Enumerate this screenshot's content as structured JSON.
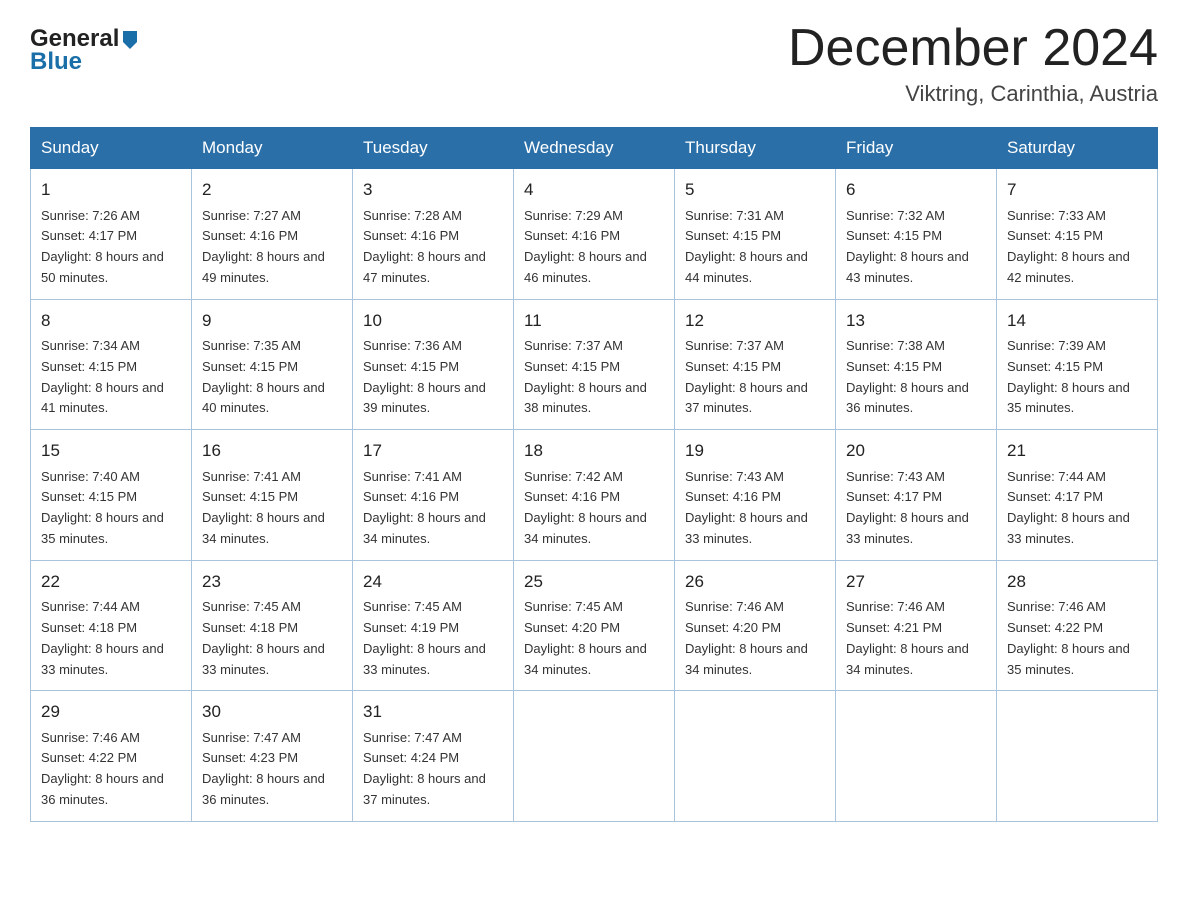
{
  "header": {
    "logo_general": "General",
    "logo_blue": "Blue",
    "month_title": "December 2024",
    "location": "Viktring, Carinthia, Austria"
  },
  "days_of_week": [
    "Sunday",
    "Monday",
    "Tuesday",
    "Wednesday",
    "Thursday",
    "Friday",
    "Saturday"
  ],
  "weeks": [
    [
      {
        "day": "1",
        "sunrise": "7:26 AM",
        "sunset": "4:17 PM",
        "daylight": "8 hours and 50 minutes."
      },
      {
        "day": "2",
        "sunrise": "7:27 AM",
        "sunset": "4:16 PM",
        "daylight": "8 hours and 49 minutes."
      },
      {
        "day": "3",
        "sunrise": "7:28 AM",
        "sunset": "4:16 PM",
        "daylight": "8 hours and 47 minutes."
      },
      {
        "day": "4",
        "sunrise": "7:29 AM",
        "sunset": "4:16 PM",
        "daylight": "8 hours and 46 minutes."
      },
      {
        "day": "5",
        "sunrise": "7:31 AM",
        "sunset": "4:15 PM",
        "daylight": "8 hours and 44 minutes."
      },
      {
        "day": "6",
        "sunrise": "7:32 AM",
        "sunset": "4:15 PM",
        "daylight": "8 hours and 43 minutes."
      },
      {
        "day": "7",
        "sunrise": "7:33 AM",
        "sunset": "4:15 PM",
        "daylight": "8 hours and 42 minutes."
      }
    ],
    [
      {
        "day": "8",
        "sunrise": "7:34 AM",
        "sunset": "4:15 PM",
        "daylight": "8 hours and 41 minutes."
      },
      {
        "day": "9",
        "sunrise": "7:35 AM",
        "sunset": "4:15 PM",
        "daylight": "8 hours and 40 minutes."
      },
      {
        "day": "10",
        "sunrise": "7:36 AM",
        "sunset": "4:15 PM",
        "daylight": "8 hours and 39 minutes."
      },
      {
        "day": "11",
        "sunrise": "7:37 AM",
        "sunset": "4:15 PM",
        "daylight": "8 hours and 38 minutes."
      },
      {
        "day": "12",
        "sunrise": "7:37 AM",
        "sunset": "4:15 PM",
        "daylight": "8 hours and 37 minutes."
      },
      {
        "day": "13",
        "sunrise": "7:38 AM",
        "sunset": "4:15 PM",
        "daylight": "8 hours and 36 minutes."
      },
      {
        "day": "14",
        "sunrise": "7:39 AM",
        "sunset": "4:15 PM",
        "daylight": "8 hours and 35 minutes."
      }
    ],
    [
      {
        "day": "15",
        "sunrise": "7:40 AM",
        "sunset": "4:15 PM",
        "daylight": "8 hours and 35 minutes."
      },
      {
        "day": "16",
        "sunrise": "7:41 AM",
        "sunset": "4:15 PM",
        "daylight": "8 hours and 34 minutes."
      },
      {
        "day": "17",
        "sunrise": "7:41 AM",
        "sunset": "4:16 PM",
        "daylight": "8 hours and 34 minutes."
      },
      {
        "day": "18",
        "sunrise": "7:42 AM",
        "sunset": "4:16 PM",
        "daylight": "8 hours and 34 minutes."
      },
      {
        "day": "19",
        "sunrise": "7:43 AM",
        "sunset": "4:16 PM",
        "daylight": "8 hours and 33 minutes."
      },
      {
        "day": "20",
        "sunrise": "7:43 AM",
        "sunset": "4:17 PM",
        "daylight": "8 hours and 33 minutes."
      },
      {
        "day": "21",
        "sunrise": "7:44 AM",
        "sunset": "4:17 PM",
        "daylight": "8 hours and 33 minutes."
      }
    ],
    [
      {
        "day": "22",
        "sunrise": "7:44 AM",
        "sunset": "4:18 PM",
        "daylight": "8 hours and 33 minutes."
      },
      {
        "day": "23",
        "sunrise": "7:45 AM",
        "sunset": "4:18 PM",
        "daylight": "8 hours and 33 minutes."
      },
      {
        "day": "24",
        "sunrise": "7:45 AM",
        "sunset": "4:19 PM",
        "daylight": "8 hours and 33 minutes."
      },
      {
        "day": "25",
        "sunrise": "7:45 AM",
        "sunset": "4:20 PM",
        "daylight": "8 hours and 34 minutes."
      },
      {
        "day": "26",
        "sunrise": "7:46 AM",
        "sunset": "4:20 PM",
        "daylight": "8 hours and 34 minutes."
      },
      {
        "day": "27",
        "sunrise": "7:46 AM",
        "sunset": "4:21 PM",
        "daylight": "8 hours and 34 minutes."
      },
      {
        "day": "28",
        "sunrise": "7:46 AM",
        "sunset": "4:22 PM",
        "daylight": "8 hours and 35 minutes."
      }
    ],
    [
      {
        "day": "29",
        "sunrise": "7:46 AM",
        "sunset": "4:22 PM",
        "daylight": "8 hours and 36 minutes."
      },
      {
        "day": "30",
        "sunrise": "7:47 AM",
        "sunset": "4:23 PM",
        "daylight": "8 hours and 36 minutes."
      },
      {
        "day": "31",
        "sunrise": "7:47 AM",
        "sunset": "4:24 PM",
        "daylight": "8 hours and 37 minutes."
      },
      null,
      null,
      null,
      null
    ]
  ]
}
